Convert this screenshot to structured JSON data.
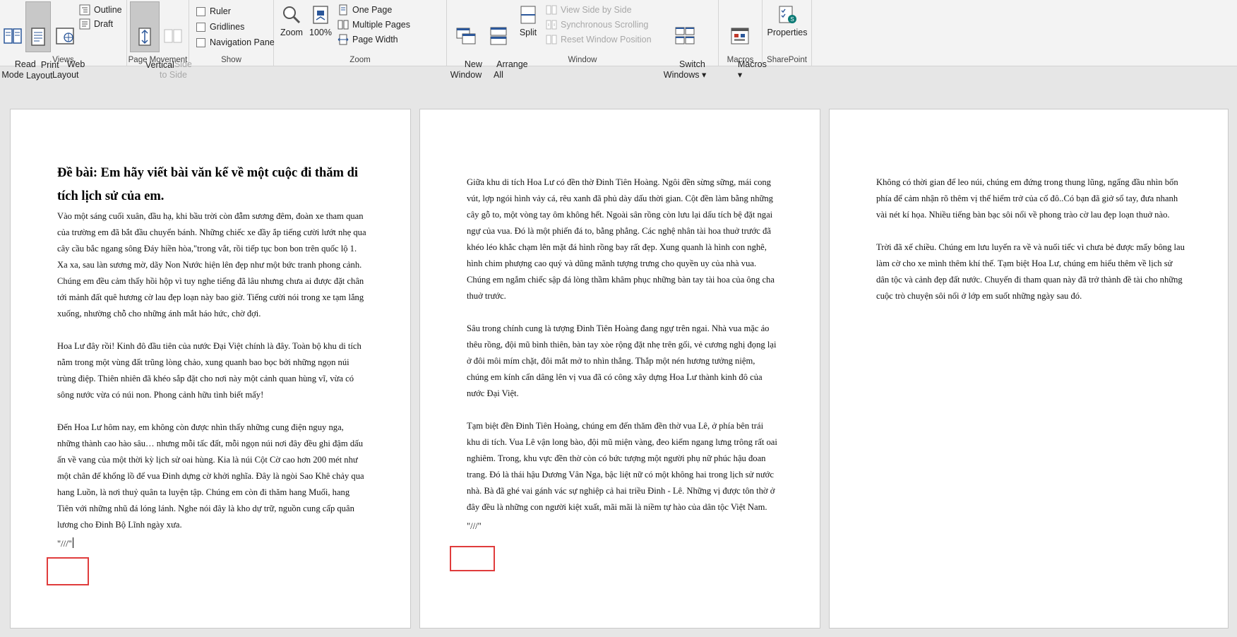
{
  "ribbon": {
    "views": {
      "label": "Views",
      "read_mode": "Read\nMode",
      "print_layout": "Print\nLayout",
      "web_layout": "Web\nLayout",
      "outline": "Outline",
      "draft": "Draft"
    },
    "page_movement": {
      "label": "Page Movement",
      "vertical": "Vertical",
      "side_to_side": "Side\nto Side"
    },
    "show": {
      "label": "Show",
      "ruler": "Ruler",
      "gridlines": "Gridlines",
      "navigation_pane": "Navigation Pane"
    },
    "zoom": {
      "label": "Zoom",
      "zoom": "Zoom",
      "hundred": "100%",
      "one_page": "One Page",
      "multiple_pages": "Multiple Pages",
      "page_width": "Page Width"
    },
    "window": {
      "label": "Window",
      "new_window": "New\nWindow",
      "arrange_all": "Arrange\nAll",
      "split": "Split",
      "view_side_by_side": "View Side by Side",
      "synchronous_scrolling": "Synchronous Scrolling",
      "reset_window_position": "Reset Window Position",
      "switch_windows": "Switch\nWindows ▾"
    },
    "macros": {
      "label": "Macros",
      "macros": "Macros\n▾"
    },
    "sharepoint": {
      "label": "SharePoint",
      "properties": "Properties"
    }
  },
  "document": {
    "page1": {
      "title": "Đề bài: Em hãy viết bài văn kể về một cuộc đi thăm di tích lịch sử của em.",
      "paragraphs": [
        "Vào một sáng cuối xuân, đầu hạ, khi bầu trời còn đẫm sương đêm, đoàn xe tham quan của trường em đã bắt đầu chuyển bánh. Những chiếc xe đầy ắp tiếng cười lướt nhẹ qua cây cầu bắc ngang sông Đáy hiền hòa,\"trong vắt, rồi tiếp tục bon bon trên quốc lộ 1. Xa xa, sau làn sương mờ, dãy Non Nước hiện lên đẹp như một bức tranh phong cảnh. Chúng em đều cảm thấy hồi hộp vì tuy nghe tiếng đã lâu nhưng chưa ai được đặt chân tới mảnh đất quê hương cờ lau đẹp loạn này bao giờ. Tiếng cười nói trong xe tạm lắng xuống, nhường chỗ cho những ánh mắt háo hức, chờ đợi.",
        "Hoa Lư đây rồi! Kinh đô đầu tiên của nước Đại Việt chính là đây. Toàn bộ khu di tích nằm trong một vùng đất trũng lòng chảo, xung quanh bao bọc bởi những ngọn núi trùng điệp. Thiên nhiên đã khéo sắp đặt cho nơi này một cảnh quan hùng vĩ, vừa có sông nước vừa có núi non. Phong cảnh hữu tình biết mấy!",
        "Đến Hoa Lư hôm nay, em không còn được nhìn thấy những cung điện nguy nga, những thành cao hào sâu… nhưng mỗi tấc đất, mỗi ngọn núi nơi đây đều ghi đậm dấu ấn về vang của một thời kỳ lịch sử oai hùng. Kia là núi Cột Cờ cao hơn 200 mét như một chân đế khổng lồ để vua Đinh dựng cờ khởi nghĩa. Đây là ngòi Sao Khê chảy qua hang Luồn, là nơi thuỷ quân ta luyện tập. Chúng em còn đi thăm hang Muối, hang Tiên với những nhũ đá lóng lánh. Nghe nói đây là kho dự trữ, nguồn cung cấp quân lương cho Đinh Bộ Lĩnh ngày xưa."
      ],
      "marker": "\"///\""
    },
    "page2": {
      "paragraphs": [
        "Giữa khu di tích Hoa Lư có đền thờ Đinh Tiên Hoàng. Ngôi đền sừng sững, mái cong vút, lợp ngói hình vảy cá, rêu xanh đã phủ dày dấu thời gian. Cột đền làm bằng những cây gỗ to, một vòng tay ôm không hết. Ngoài sân rồng còn lưu lại dấu tích bệ đặt ngai ngự của vua. Đó là một phiến đá to, bằng phẳng. Các nghệ nhân tài hoa thuở trước đã khéo léo khắc chạm lên mặt đá hình rồng bay rất đẹp. Xung quanh là hình con nghê, hình chim phượng cao quý và dũng mãnh tượng trưng cho quyền uy của nhà vua. Chúng em ngắm chiếc sập đá lòng thầm khâm phục những bàn tay tài hoa của ông cha thuở trước.",
        "Sâu trong chính cung là tượng Đinh Tiên Hoàng đang ngự trên ngai. Nhà vua mặc áo thêu rồng, đội mũ bình thiên, bàn tay xòe rộng đặt nhẹ trên gối, vẻ cương nghị đọng lại ở đôi môi mím chặt, đôi mắt mở to nhìn thẳng. Thắp một nén hương tưởng niệm, chúng em kính cẩn dâng lên vị vua đã có công xây dựng Hoa Lư thành kinh đô của nước Đại Việt.",
        "Tạm biệt đền Đinh Tiên Hoàng, chúng em đến thăm đền thờ vua Lê, ở phía bên trái khu di tích. Vua Lê vận long bào, đội mũ miện vàng, đeo kiếm ngang lưng trông rất oai nghiêm. Trong, khu vực đền thờ còn có bức tượng một người phụ nữ phúc hậu đoan trang. Đó là thái hậu Dương Vân Nga, bậc liệt nữ có một không hai trong lịch sử nước nhà. Bà đã ghé vai gánh vác sự nghiệp cả hai triều Đinh - Lê. Những vị được tôn thờ ở đây đều là những con người kiệt xuất, mãi mãi là niềm tự hào của dân tộc Việt Nam."
      ],
      "marker": "\"///\""
    },
    "page3": {
      "paragraphs": [
        "Không có thời gian để leo núi, chúng em đứng trong thung lũng, ngẩng đầu nhìn bốn phía để cảm nhận rõ thêm vị thế hiểm trở của cố đô..Có bạn đã giở sổ tay, đưa nhanh vài nét kí họa. Nhiều tiếng bàn bạc sôi nổi về phong trào cờ lau đẹp loạn thuở nào.",
        "Trời đã xế chiều. Chúng em lưu luyến ra về và nuối tiếc vì chưa bẻ được mấy bông lau làm cờ cho xe mình thêm khí thế. Tạm biệt Hoa Lư, chúng em hiểu thêm về lịch sử dân tộc và cảnh đẹp đất nước. Chuyến đi tham quan này đã trở thành đề tài cho những cuộc trò chuyện sôi nổi ở lớp em suốt những ngày sau đó."
      ]
    }
  },
  "colors": {
    "highlight": "#e03c3c",
    "ribbon_bg": "#f3f3f3",
    "canvas_bg": "#e6e6e6",
    "accent_blue": "#2b579a"
  }
}
